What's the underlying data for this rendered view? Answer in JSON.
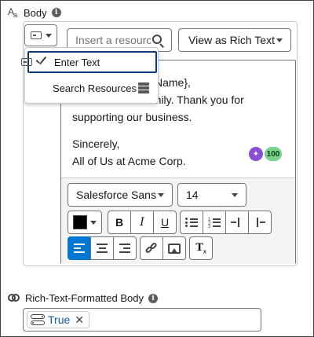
{
  "body_field": {
    "label": "Body",
    "info_glyph": "i",
    "aa_big": "A",
    "aa_small": "a"
  },
  "toolbar_top": {
    "search_placeholder": "Insert a resource",
    "view_select_value": "View as Rich Text"
  },
  "mode_dropdown": {
    "items": [
      {
        "label": "Enter Text",
        "selected": true,
        "icon": "text-field-icon"
      },
      {
        "label": "Search Resources",
        "selected": false,
        "icon": "database-icon"
      }
    ]
  },
  "editor": {
    "lines": [
      "Name},",
      "amily. Thank you for",
      "supporting our business.",
      "",
      "Sincerely,",
      "All of Us at Acme Corp."
    ],
    "ai_glyph": "✦",
    "score": "100"
  },
  "format_toolbar": {
    "font_family": "Salesforce Sans",
    "font_size": "14",
    "text_color": "#000000",
    "bold": "B",
    "italic": "I",
    "underline": "U",
    "clear_format": "T",
    "clear_format_sub": "x",
    "alignment_selected": "left",
    "accent_color": "#0176d3"
  },
  "rtf_field": {
    "label": "Rich-Text-Formatted Body",
    "info_glyph": "i",
    "pill_value": "True",
    "pill_remove": "✕"
  }
}
